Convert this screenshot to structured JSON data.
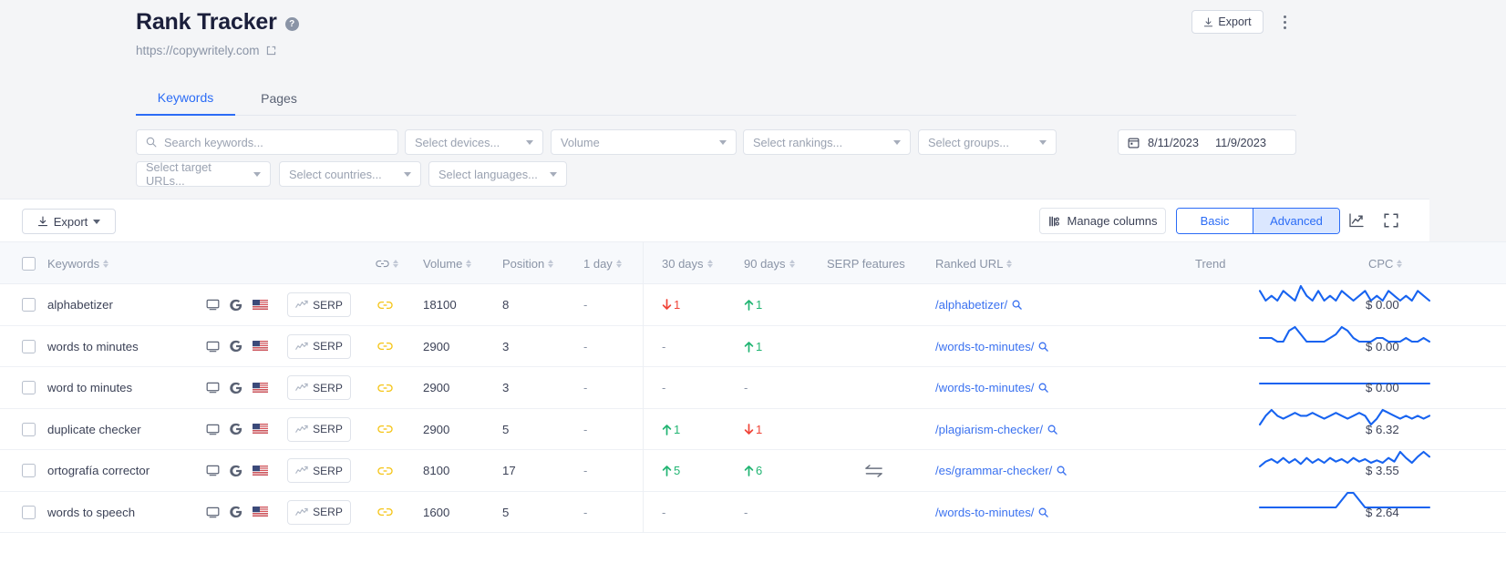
{
  "header": {
    "title": "Rank Tracker",
    "help_icon": "help-circle-icon",
    "site_url": "https://copywritely.com",
    "external_link_icon": "external-link-icon",
    "export_label": "Export",
    "export_icon": "download-icon",
    "kebab_icon": "more-vertical-icon"
  },
  "tabs": [
    {
      "label": "Keywords",
      "active": true
    },
    {
      "label": "Pages",
      "active": false
    }
  ],
  "filters": {
    "search_placeholder": "Search keywords...",
    "search_value": "",
    "search_icon": "search-icon",
    "devices": "Select devices...",
    "volume": "Volume",
    "rankings": "Select rankings...",
    "groups": "Select groups...",
    "target_urls": "Select target URLs...",
    "countries": "Select countries...",
    "languages": "Select languages...",
    "date_icon": "calendar-icon",
    "date_from": "8/11/2023",
    "date_sep": " ",
    "date_to": "11/9/2023"
  },
  "toolbar": {
    "export_label": "Export",
    "export_icon": "download-icon",
    "manage_columns_label": "Manage columns",
    "manage_columns_icon": "columns-icon",
    "view_basic": "Basic",
    "view_advanced": "Advanced",
    "active_view": "Advanced",
    "chart_icon": "trend-chart-icon",
    "fullscreen_icon": "expand-icon"
  },
  "table": {
    "columns": [
      {
        "key": "checkbox",
        "label": "",
        "sortable": false
      },
      {
        "key": "keywords",
        "label": "Keywords",
        "sortable": true
      },
      {
        "key": "link",
        "label": "",
        "sortable": true,
        "icon": "link-icon"
      },
      {
        "key": "volume",
        "label": "Volume",
        "sortable": true
      },
      {
        "key": "position",
        "label": "Position",
        "sortable": true
      },
      {
        "key": "day1",
        "label": "1 day",
        "sortable": true
      },
      {
        "key": "days30",
        "label": "30 days",
        "sortable": true
      },
      {
        "key": "days90",
        "label": "90 days",
        "sortable": true
      },
      {
        "key": "serp_features",
        "label": "SERP features",
        "sortable": false
      },
      {
        "key": "ranked_url",
        "label": "Ranked URL",
        "sortable": true
      },
      {
        "key": "trend",
        "label": "Trend",
        "sortable": false
      },
      {
        "key": "cpc",
        "label": "CPC",
        "sortable": true
      }
    ],
    "serp_button_label": "SERP",
    "rows": [
      {
        "keyword": "alphabetizer",
        "device": "desktop-icon",
        "engine": "google-icon",
        "country": "us-flag-icon",
        "volume": "18100",
        "position": "8",
        "day1": "-",
        "days30": {
          "dir": "down",
          "value": "1"
        },
        "days90": {
          "dir": "up",
          "value": "1"
        },
        "serp_features": "",
        "ranked_url": "/alphabetizer/",
        "cpc": "$ 0.00",
        "trend": [
          52,
          50,
          51,
          50,
          52,
          51,
          50,
          53,
          51,
          50,
          52,
          50,
          51,
          50,
          52,
          51,
          50,
          51,
          52,
          50,
          51,
          50,
          52,
          51,
          50,
          51,
          50,
          52,
          51,
          50
        ]
      },
      {
        "keyword": "words to minutes",
        "device": "desktop-icon",
        "engine": "google-icon",
        "country": "us-flag-icon",
        "volume": "2900",
        "position": "3",
        "day1": "-",
        "days30": {
          "dir": "none",
          "value": "-"
        },
        "days90": {
          "dir": "up",
          "value": "1"
        },
        "serp_features": "",
        "ranked_url": "/words-to-minutes/",
        "cpc": "$ 0.00",
        "trend": [
          51,
          51,
          51,
          50,
          50,
          53,
          54,
          52,
          50,
          50,
          50,
          50,
          51,
          52,
          54,
          53,
          51,
          50,
          50,
          50,
          51,
          51,
          50,
          50,
          50,
          51,
          50,
          50,
          51,
          50
        ]
      },
      {
        "keyword": "word to minutes",
        "device": "desktop-icon",
        "engine": "google-icon",
        "country": "us-flag-icon",
        "volume": "2900",
        "position": "3",
        "day1": "-",
        "days30": {
          "dir": "none",
          "value": "-"
        },
        "days90": {
          "dir": "none",
          "value": "-"
        },
        "serp_features": "",
        "ranked_url": "/words-to-minutes/",
        "cpc": "$ 0.00",
        "trend": [
          50,
          50,
          50,
          50,
          50,
          50,
          50,
          50,
          50,
          50,
          50,
          50,
          50,
          50,
          50,
          50,
          50,
          50,
          50,
          50,
          50,
          50,
          50,
          50,
          50,
          50,
          50,
          50,
          50,
          50
        ]
      },
      {
        "keyword": "duplicate checker",
        "device": "desktop-icon",
        "engine": "google-icon",
        "country": "us-flag-icon",
        "volume": "2900",
        "position": "5",
        "day1": "-",
        "days30": {
          "dir": "up",
          "value": "1"
        },
        "days90": {
          "dir": "down",
          "value": "1"
        },
        "serp_features": "",
        "ranked_url": "/plagiarism-checker/",
        "cpc": "$ 6.32",
        "trend": [
          50,
          53,
          55,
          53,
          52,
          53,
          54,
          53,
          53,
          54,
          53,
          52,
          53,
          54,
          53,
          52,
          53,
          54,
          53,
          50,
          52,
          55,
          54,
          53,
          52,
          53,
          52,
          53,
          52,
          53
        ]
      },
      {
        "keyword": "ortografía corrector",
        "device": "desktop-icon",
        "engine": "google-icon",
        "country": "us-flag-icon",
        "volume": "8100",
        "position": "17",
        "day1": "-",
        "days30": {
          "dir": "up",
          "value": "5"
        },
        "days90": {
          "dir": "up",
          "value": "6"
        },
        "serp_features": "swap-arrows-icon",
        "ranked_url": "/es/grammar-checker/",
        "cpc": "$ 3.55",
        "trend": [
          50,
          54,
          56,
          53,
          57,
          53,
          56,
          52,
          57,
          53,
          56,
          53,
          57,
          54,
          56,
          53,
          57,
          54,
          56,
          53,
          55,
          53,
          57,
          54,
          62,
          57,
          53,
          58,
          62,
          58
        ]
      },
      {
        "keyword": "words to speech",
        "device": "desktop-icon",
        "engine": "google-icon",
        "country": "us-flag-icon",
        "volume": "1600",
        "position": "5",
        "day1": "-",
        "days30": {
          "dir": "none",
          "value": "-"
        },
        "days90": {
          "dir": "none",
          "value": "-"
        },
        "serp_features": "",
        "ranked_url": "/words-to-minutes/",
        "cpc": "$ 2.64",
        "trend": [
          51,
          51,
          51,
          51,
          51,
          51,
          51,
          51,
          51,
          51,
          51,
          51,
          51,
          51,
          52,
          53,
          53,
          52,
          51,
          51,
          51,
          51,
          51,
          51,
          51,
          51,
          51,
          51,
          51,
          51
        ]
      }
    ]
  }
}
